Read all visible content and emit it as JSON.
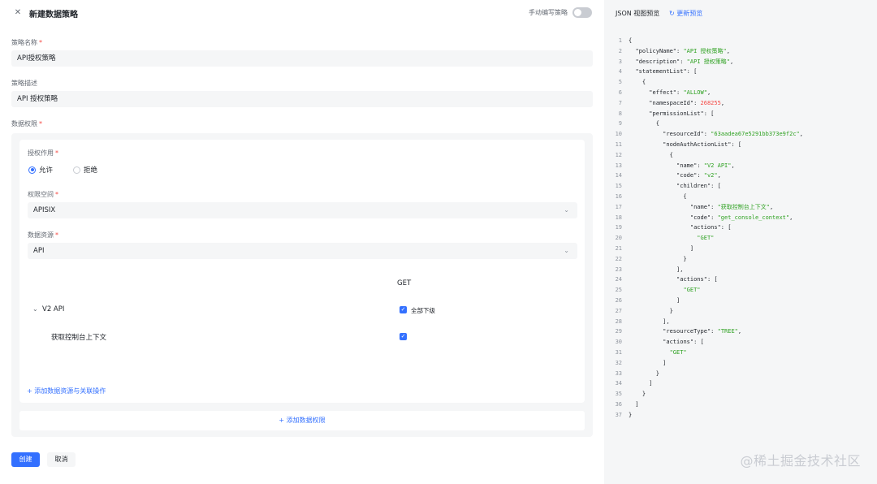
{
  "header": {
    "title": "新建数据策略",
    "manual_label": "手动编写策略"
  },
  "form": {
    "policy_name_label": "策略名称",
    "policy_name_value": "API授权策略",
    "description_label": "策略描述",
    "description_value": "API 授权策略",
    "data_perm_label": "数据权限",
    "required_mark": "*"
  },
  "perm": {
    "effect_label": "授权作用",
    "allow_label": "允许",
    "deny_label": "拒绝",
    "namespace_label": "权限空间",
    "namespace_value": "APISIX",
    "resource_label": "数据资源",
    "resource_value": "API",
    "column_get": "GET",
    "tree_group": "V2 API",
    "select_all": "全部下级",
    "tree_child": "获取控制台上下文",
    "add_resource_link": "+ 添加数据资源与关联操作"
  },
  "add_perm": "+ 添加数据权限",
  "footer": {
    "create": "创建",
    "cancel": "取消"
  },
  "json_panel": {
    "title": "JSON 视图预览",
    "refresh": "更新预览",
    "lines": [
      "{",
      "  \"policyName\": \"API 授权策略\",",
      "  \"description\": \"API 授权策略\",",
      "  \"statementList\": [",
      "    {",
      "      \"effect\": \"ALLOW\",",
      "      \"namespaceId\": 268255,",
      "      \"permissionList\": [",
      "        {",
      "          \"resourceId\": \"63aadea67e5291bb373e9f2c\",",
      "          \"nodeAuthActionList\": [",
      "            {",
      "              \"name\": \"V2 API\",",
      "              \"code\": \"v2\",",
      "              \"children\": [",
      "                {",
      "                  \"name\": \"获取控制台上下文\",",
      "                  \"code\": \"get_console_context\",",
      "                  \"actions\": [",
      "                    \"GET\"",
      "                  ]",
      "                }",
      "              ],",
      "              \"actions\": [",
      "                \"GET\"",
      "              ]",
      "            }",
      "          ],",
      "          \"resourceType\": \"TREE\",",
      "          \"actions\": [",
      "            \"GET\"",
      "          ]",
      "        }",
      "      ]",
      "    }",
      "  ]",
      "}"
    ]
  },
  "watermark": "@稀土掘金技术社区",
  "colors": {
    "accent": "#3370ff",
    "string": "#2ea121",
    "number": "#f54a45"
  }
}
